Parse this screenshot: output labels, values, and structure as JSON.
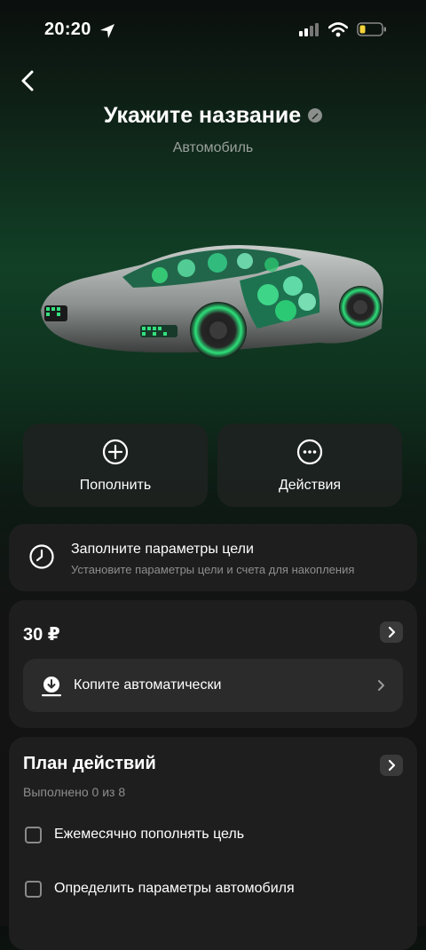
{
  "status_bar": {
    "time": "20:20"
  },
  "header": {
    "title": "Укажите название",
    "subtitle": "Автомобиль"
  },
  "actions": [
    {
      "label": "Пополнить",
      "icon": "plus-circle-icon"
    },
    {
      "label": "Действия",
      "icon": "more-circle-icon"
    }
  ],
  "goal_params": {
    "title": "Заполните параметры цели",
    "description": "Установите параметры цели и счета для накопления"
  },
  "balance": {
    "amount": "30 ₽",
    "auto_save_label": "Копите автоматически"
  },
  "plan": {
    "title": "План действий",
    "progress": "Выполнено 0 из 8",
    "tasks": [
      {
        "label": "Ежемесячно пополнять цель",
        "done": false
      },
      {
        "label": "Определить параметры автомобиля",
        "done": false
      }
    ]
  },
  "colors": {
    "accent_green": "#2bd46a",
    "card": "#1e1e1e",
    "battery_low": "#f5d33a"
  }
}
